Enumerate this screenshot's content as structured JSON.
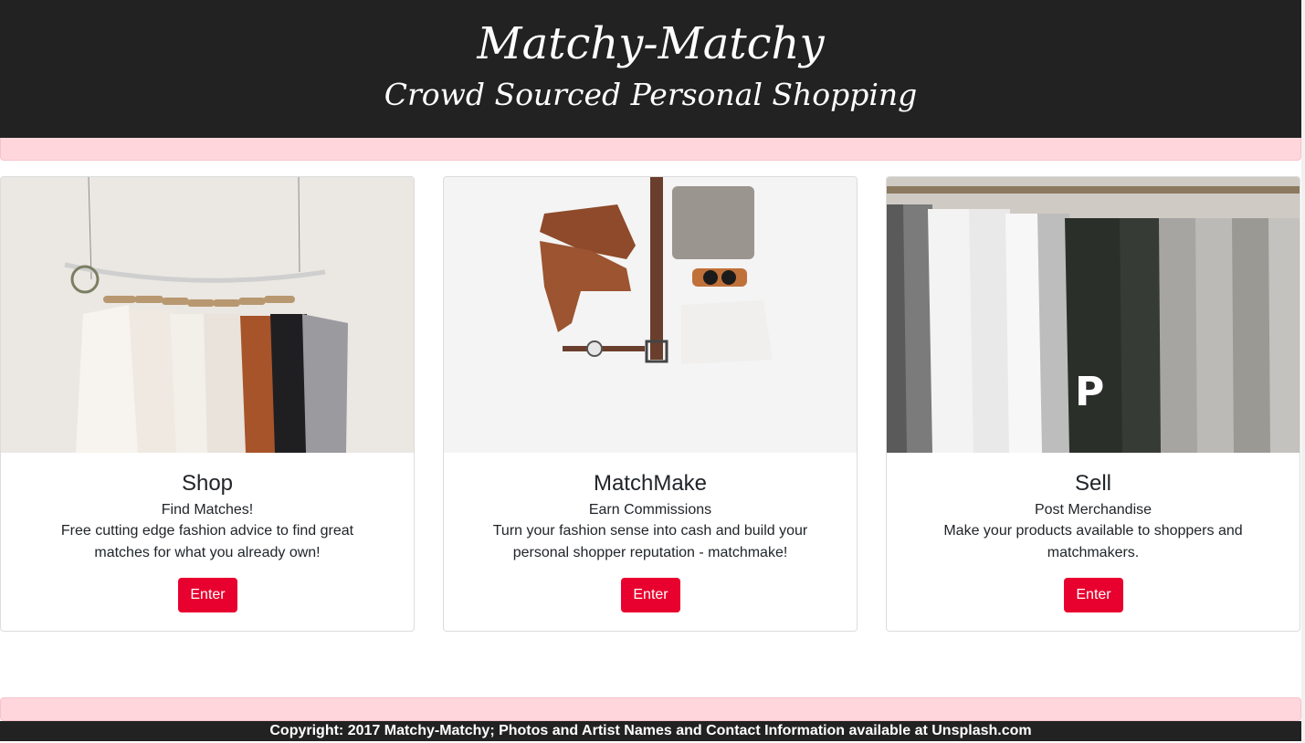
{
  "header": {
    "title": "Matchy-Matchy",
    "subtitle": "Crowd Sourced Personal Shopping"
  },
  "cards": [
    {
      "title": "Shop",
      "subtitle": "Find Matches!",
      "text": "Free cutting edge fashion advice to find great matches for what you already own!",
      "button": "Enter"
    },
    {
      "title": "MatchMake",
      "subtitle": "Earn Commissions",
      "text": "Turn your fashion sense into cash and build your personal shopper reputation - matchmake!",
      "button": "Enter"
    },
    {
      "title": "Sell",
      "subtitle": "Post Merchandise",
      "text": "Make your products available to shoppers and matchmakers.",
      "button": "Enter"
    }
  ],
  "footer": {
    "text": "Copyright: 2017 Matchy-Matchy; Photos and Artist Names and Contact Information available at Unsplash.com"
  },
  "colors": {
    "header_bg": "#222222",
    "accent_button": "#e8002e",
    "pink_bar": "#ffd6dc"
  }
}
